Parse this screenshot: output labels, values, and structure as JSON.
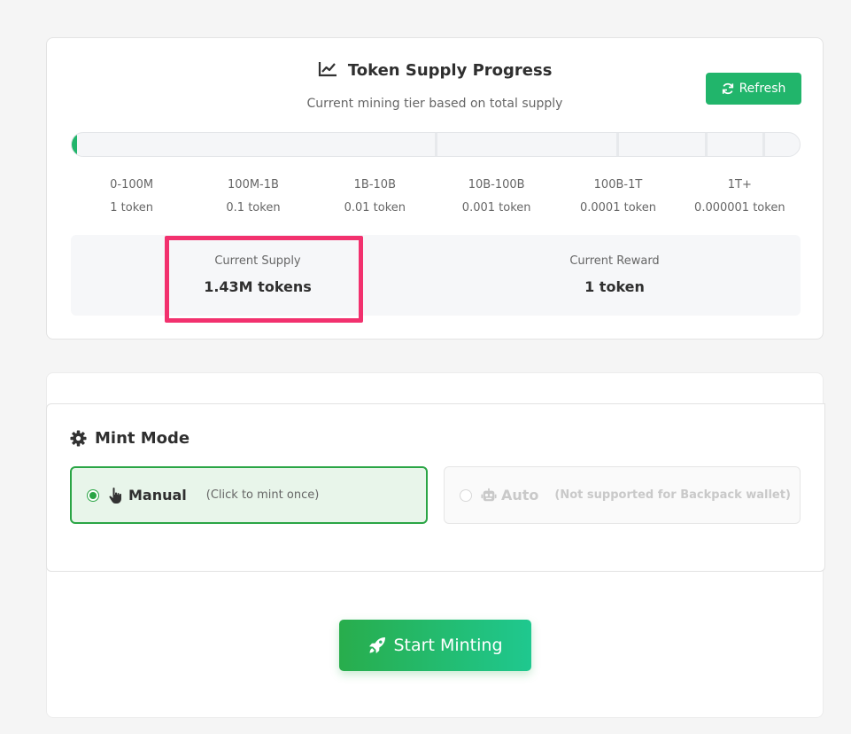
{
  "supply_card": {
    "title": "Token Supply Progress",
    "title_icon": "chart-line-icon",
    "subtitle": "Current mining tier based on total supply",
    "refresh_label": "Refresh",
    "refresh_icon": "sync-icon",
    "progress_fraction": 0.00143,
    "tiers": [
      {
        "range": "0-100M",
        "reward": "1 token"
      },
      {
        "range": "100M-1B",
        "reward": "0.1 token"
      },
      {
        "range": "1B-10B",
        "reward": "0.01 token"
      },
      {
        "range": "10B-100B",
        "reward": "0.001 token"
      },
      {
        "range": "100B-1T",
        "reward": "0.0001 token"
      },
      {
        "range": "1T+",
        "reward": "0.000001 token"
      }
    ],
    "current_supply_label": "Current Supply",
    "current_supply_value": "1.43M tokens",
    "current_reward_label": "Current Reward",
    "current_reward_value": "1 token"
  },
  "mint_card": {
    "mode_title": "Mint Mode",
    "mode_icon": "gear-icon",
    "options": [
      {
        "label": "Manual",
        "hint": "(Click to mint once)",
        "icon": "pointer-hand-icon",
        "selected": true,
        "enabled": true
      },
      {
        "label": "Auto",
        "hint": "(Not supported for Backpack wallet)",
        "icon": "robot-icon",
        "selected": false,
        "enabled": false
      }
    ],
    "start_label": "Start Minting",
    "start_icon": "rocket-icon"
  },
  "colors": {
    "accent_green": "#21b56b",
    "highlight_pink": "#f2316e",
    "selected_bg": "#e8f5ea"
  }
}
